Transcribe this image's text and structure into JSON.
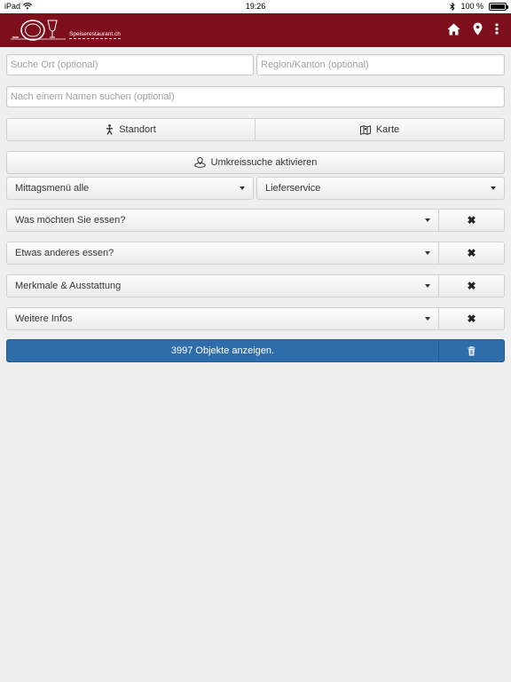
{
  "status_bar": {
    "device": "iPad",
    "time": "19:26",
    "battery": "100 %"
  },
  "header": {
    "logo_text": "Speiserestaurant.ch",
    "icons": [
      "home-icon",
      "location-pin-icon",
      "more-vertical-icon"
    ],
    "background_color": "#7c0f1b"
  },
  "search": {
    "location_placeholder": "Suche Ort (optional)",
    "region_placeholder": "Region/Kanton (optional)",
    "name_placeholder": "Nach einem Namen suchen (optional)"
  },
  "buttons": {
    "standort": "Standort",
    "karte": "Karte",
    "radius": "Umkreissuche aktivieren"
  },
  "selects": {
    "mittagsmenu": "Mittagsmenü alle",
    "lieferservice": "Lieferservice"
  },
  "filters": [
    {
      "label": "Was möchten Sie essen?"
    },
    {
      "label": "Etwas anderes essen?"
    },
    {
      "label": "Merkmale & Ausstattung"
    },
    {
      "label": "Weitere Infos"
    }
  ],
  "results": {
    "label": "3997 Objekte anzeigen.",
    "color": "#2e6da9"
  }
}
